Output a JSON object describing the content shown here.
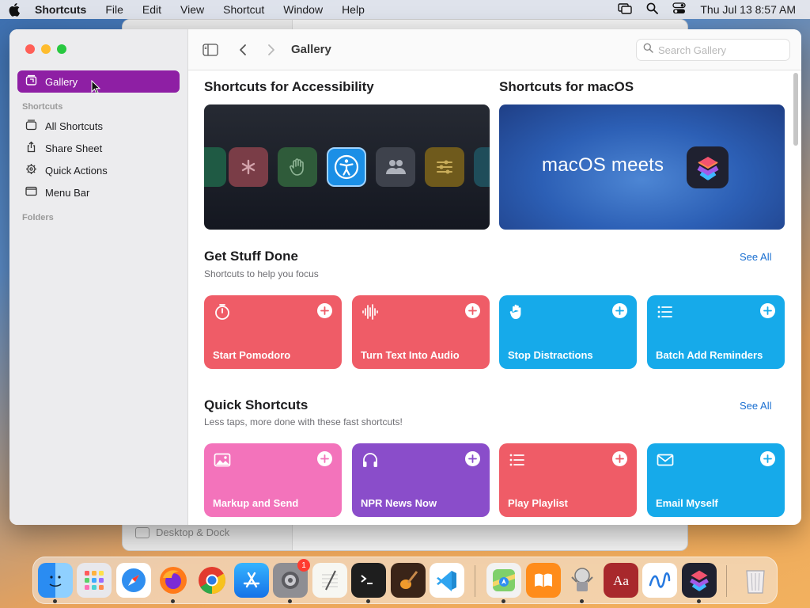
{
  "menubar": {
    "app": "Shortcuts",
    "items": [
      "File",
      "Edit",
      "View",
      "Shortcut",
      "Window",
      "Help"
    ],
    "clock": "Thu Jul 13  8:57 AM"
  },
  "background_window": {
    "row_label": "Desktop & Dock"
  },
  "sidebar": {
    "gallery": "Gallery",
    "section_shortcuts": "Shortcuts",
    "items": [
      {
        "label": "All Shortcuts",
        "icon": "stack-icon"
      },
      {
        "label": "Share Sheet",
        "icon": "share-icon"
      },
      {
        "label": "Quick Actions",
        "icon": "gear-icon"
      },
      {
        "label": "Menu Bar",
        "icon": "menubar-icon"
      }
    ],
    "section_folders": "Folders"
  },
  "toolbar": {
    "title": "Gallery",
    "search_placeholder": "Search Gallery"
  },
  "banners": {
    "accessibility_title": "Shortcuts for Accessibility",
    "macos_title": "Shortcuts for macOS",
    "macos_text": "macOS meets"
  },
  "get_stuff_done": {
    "title": "Get Stuff Done",
    "subtitle": "Shortcuts to help you focus",
    "see_all": "See All",
    "cards": [
      {
        "label": "Start Pomodoro",
        "color": "#ee5b66",
        "icon": "timer-icon"
      },
      {
        "label": "Turn Text Into Audio",
        "color": "#ee5b66",
        "icon": "waveform-icon"
      },
      {
        "label": "Stop Distractions",
        "color": "#1aa9ea",
        "icon": "hand-icon"
      },
      {
        "label": "Batch Add Reminders",
        "color": "#1aa9ea",
        "icon": "list-icon"
      }
    ]
  },
  "quick_shortcuts": {
    "title": "Quick Shortcuts",
    "subtitle": "Less taps, more done with these fast shortcuts!",
    "see_all": "See All",
    "cards": [
      {
        "label": "Markup and Send",
        "color": "#f26fb8",
        "icon": "photo-icon"
      },
      {
        "label": "NPR News Now",
        "color": "#8a4ec9",
        "icon": "headphones-icon"
      },
      {
        "label": "Play Playlist",
        "color": "#ee5b66",
        "icon": "list-icon"
      },
      {
        "label": "Email Myself",
        "color": "#1aa9ea",
        "icon": "envelope-icon"
      }
    ]
  },
  "dock": {
    "apps": [
      "Finder",
      "Launchpad",
      "Safari",
      "Firefox",
      "Chrome",
      "App Store",
      "System Settings",
      "TextEdit",
      "Terminal",
      "GarageBand",
      "VS Code",
      "Maps",
      "Books",
      "Automator",
      "Dictionary",
      "Freeform",
      "Shortcuts",
      "Trash"
    ],
    "settings_badge": "1"
  },
  "colors": {
    "accent": "#8e1fa4",
    "link": "#1a6fd1"
  }
}
